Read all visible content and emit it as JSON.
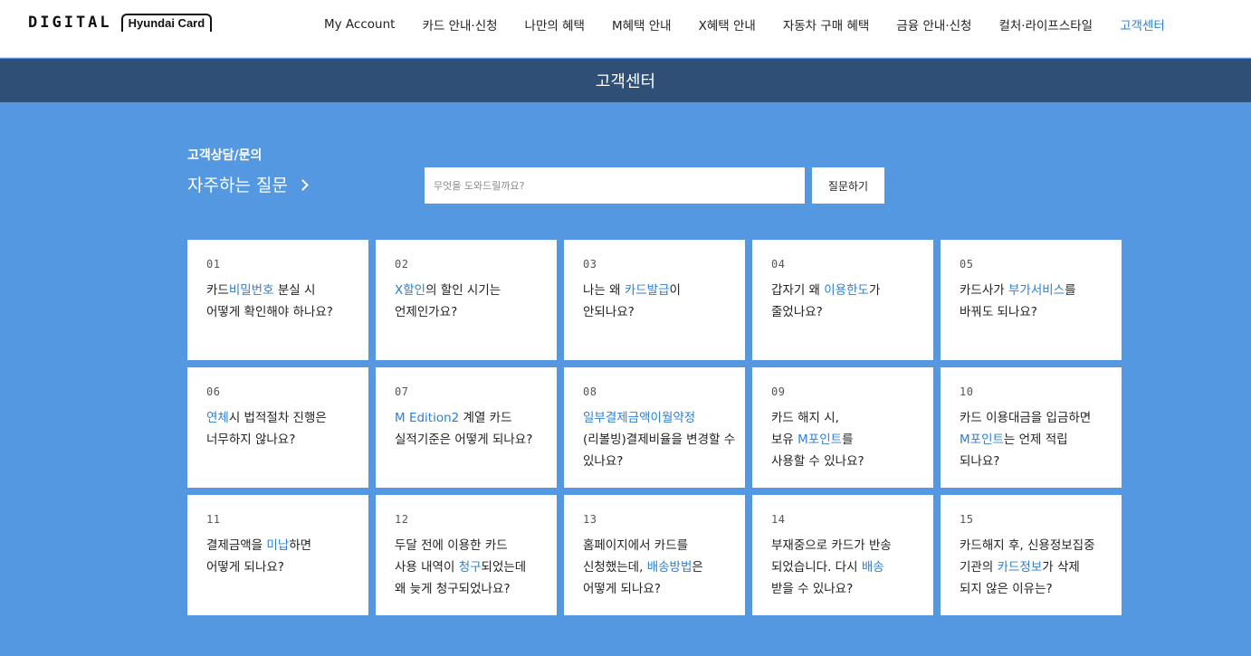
{
  "logo": {
    "word": "DIGITAL",
    "brand": "Hyundai Card"
  },
  "nav": [
    {
      "label": "My Account",
      "active": false
    },
    {
      "label": "카드 안내·신청",
      "active": false
    },
    {
      "label": "나만의 혜택",
      "active": false
    },
    {
      "label": "M혜택 안내",
      "active": false
    },
    {
      "label": "X혜택 안내",
      "active": false
    },
    {
      "label": "자동차 구매 혜택",
      "active": false
    },
    {
      "label": "금융 안내·신청",
      "active": false
    },
    {
      "label": "컬처·라이프스타일",
      "active": false
    },
    {
      "label": "고객센터",
      "active": true
    }
  ],
  "band_title": "고객센터",
  "breadcrumb": "고객상담/문의",
  "faq_title": "자주하는 질문",
  "search": {
    "placeholder": "무엇을 도와드릴까요?",
    "value": ""
  },
  "ask_button": "질문하기",
  "colors": {
    "highlight": "#2d7fd3",
    "band": "#2f4f76",
    "background": "#5398e0"
  },
  "faqs": [
    {
      "num": "01",
      "lines": [
        [
          {
            "t": "카드"
          },
          {
            "t": "비밀번호",
            "hl": true
          },
          {
            "t": " 분실 시"
          }
        ],
        [
          {
            "t": "어떻게 확인해야 하나요?"
          }
        ]
      ]
    },
    {
      "num": "02",
      "lines": [
        [
          {
            "t": "X할인",
            "hl": true
          },
          {
            "t": "의 할인 시기는"
          }
        ],
        [
          {
            "t": "언제인가요?"
          }
        ]
      ]
    },
    {
      "num": "03",
      "lines": [
        [
          {
            "t": "나는 왜 "
          },
          {
            "t": "카드발급",
            "hl": true
          },
          {
            "t": "이"
          }
        ],
        [
          {
            "t": "안되나요?"
          }
        ]
      ]
    },
    {
      "num": "04",
      "lines": [
        [
          {
            "t": "갑자기 왜 "
          },
          {
            "t": "이용한도",
            "hl": true
          },
          {
            "t": "가"
          }
        ],
        [
          {
            "t": "줄었나요?"
          }
        ]
      ]
    },
    {
      "num": "05",
      "lines": [
        [
          {
            "t": "카드사가 "
          },
          {
            "t": "부가서비스",
            "hl": true
          },
          {
            "t": "를"
          }
        ],
        [
          {
            "t": "바꿔도 되나요?"
          }
        ]
      ]
    },
    {
      "num": "06",
      "lines": [
        [
          {
            "t": "연체",
            "hl": true
          },
          {
            "t": "시 법적절차 진행은"
          }
        ],
        [
          {
            "t": "너무하지 않나요?"
          }
        ]
      ]
    },
    {
      "num": "07",
      "lines": [
        [
          {
            "t": "M Edition2",
            "hl": true
          },
          {
            "t": " 계열 카드"
          }
        ],
        [
          {
            "t": "실적기준은 어떻게 되나요?"
          }
        ]
      ]
    },
    {
      "num": "08",
      "lines": [
        [
          {
            "t": "일부결제금액이월약정",
            "hl": true
          }
        ],
        [
          {
            "t": "(리볼빙)결제비율을 변경할 수"
          }
        ],
        [
          {
            "t": "있나요?"
          }
        ]
      ]
    },
    {
      "num": "09",
      "lines": [
        [
          {
            "t": "카드 해지 시,"
          }
        ],
        [
          {
            "t": "보유 "
          },
          {
            "t": "M포인트",
            "hl": true
          },
          {
            "t": "를"
          }
        ],
        [
          {
            "t": "사용할 수 있나요?"
          }
        ]
      ]
    },
    {
      "num": "10",
      "lines": [
        [
          {
            "t": "카드 이용대금을 입금하면"
          }
        ],
        [
          {
            "t": "M포인트",
            "hl": true
          },
          {
            "t": "는 언제 적립"
          }
        ],
        [
          {
            "t": "되나요?"
          }
        ]
      ]
    },
    {
      "num": "11",
      "lines": [
        [
          {
            "t": "결제금액을 "
          },
          {
            "t": "미납",
            "hl": true
          },
          {
            "t": "하면"
          }
        ],
        [
          {
            "t": "어떻게 되나요?"
          }
        ]
      ]
    },
    {
      "num": "12",
      "lines": [
        [
          {
            "t": "두달 전에 이용한 카드"
          }
        ],
        [
          {
            "t": "사용 내역이 "
          },
          {
            "t": "청구",
            "hl": true
          },
          {
            "t": "되었는데"
          }
        ],
        [
          {
            "t": "왜 늦게 청구되었나요?"
          }
        ]
      ]
    },
    {
      "num": "13",
      "lines": [
        [
          {
            "t": "홈페이지에서 카드를"
          }
        ],
        [
          {
            "t": "신청했는데, "
          },
          {
            "t": "배송방법",
            "hl": true
          },
          {
            "t": "은"
          }
        ],
        [
          {
            "t": "어떻게 되나요?"
          }
        ]
      ]
    },
    {
      "num": "14",
      "lines": [
        [
          {
            "t": "부재중으로 카드가 반송"
          }
        ],
        [
          {
            "t": "되었습니다. 다시 "
          },
          {
            "t": "배송",
            "hl": true
          }
        ],
        [
          {
            "t": "받을 수 있나요?"
          }
        ]
      ]
    },
    {
      "num": "15",
      "lines": [
        [
          {
            "t": "카드해지 후, 신용정보집중"
          }
        ],
        [
          {
            "t": "기관의 "
          },
          {
            "t": "카드정보",
            "hl": true
          },
          {
            "t": "가 삭제"
          }
        ],
        [
          {
            "t": "되지 않은 이유는?"
          }
        ]
      ]
    }
  ]
}
